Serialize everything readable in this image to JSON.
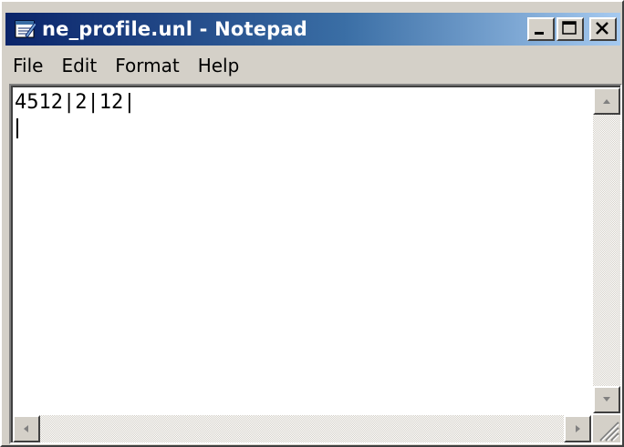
{
  "window": {
    "title": "ne_profile.unl - Notepad"
  },
  "menu": {
    "items": [
      "File",
      "Edit",
      "Format",
      "Help"
    ]
  },
  "editor": {
    "content": "4512|2|12|"
  },
  "colors": {
    "titlebar_start": "#0a246a",
    "titlebar_end": "#a6caf0",
    "chrome": "#d4d0c8"
  },
  "icons": {
    "app": "notepad-icon",
    "minimize": "minimize-icon",
    "maximize": "maximize-icon",
    "close": "close-icon",
    "scroll_up": "arrow-up-icon",
    "scroll_down": "arrow-down-icon",
    "scroll_left": "arrow-left-icon",
    "scroll_right": "arrow-right-icon",
    "resize": "resize-grip-icon"
  }
}
